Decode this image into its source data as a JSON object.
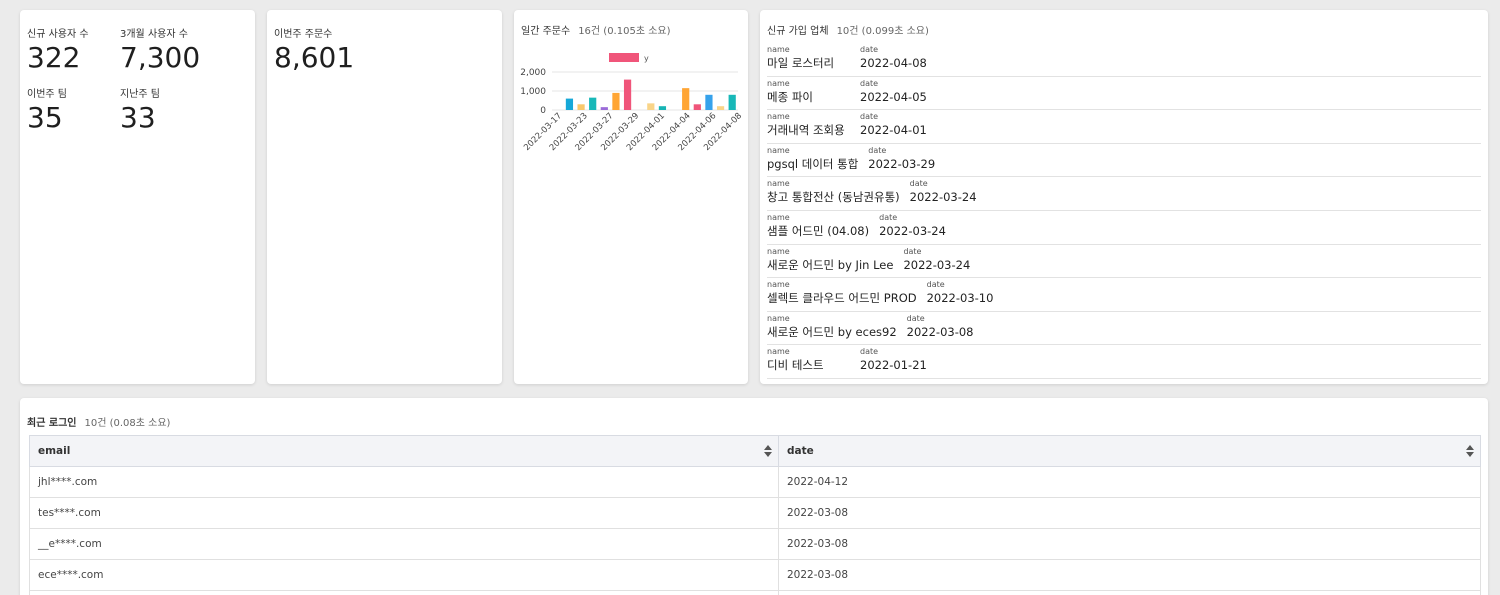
{
  "stats": {
    "new_users_label": "신규 사용자 수",
    "new_users_value": "322",
    "users_3m_label": "3개월 사용자 수",
    "users_3m_value": "7,300",
    "this_week_teams_label": "이번주 팀",
    "this_week_teams_value": "35",
    "last_week_teams_label": "지난주 팀",
    "last_week_teams_value": "33"
  },
  "orders": {
    "label": "이번주 주문수",
    "value": "8,601"
  },
  "daily_orders": {
    "title": "일간 주문수",
    "meta": "16건 (0.105초 소요)"
  },
  "chart_data": {
    "type": "bar",
    "legend": [
      "y"
    ],
    "legend_position": "top",
    "ylim": [
      0,
      2000
    ],
    "yticks": [
      "0",
      "1,000",
      "2,000"
    ],
    "xticks": [
      "2022-03-17",
      "2022-03-23",
      "2022-03-27",
      "2022-03-29",
      "2022-04-01",
      "2022-04-04",
      "2022-04-06",
      "2022-04-08"
    ],
    "x": [
      "2022-03-17",
      "2022-03-19",
      "2022-03-23",
      "2022-03-25",
      "2022-03-27",
      "2022-03-28",
      "2022-03-29",
      "2022-03-30",
      "2022-04-01",
      "2022-04-02",
      "2022-04-04",
      "2022-04-05",
      "2022-04-06",
      "2022-04-07",
      "2022-04-08",
      "2022-04-09"
    ],
    "series": [
      {
        "name": "y",
        "values": [
          0,
          600,
          300,
          650,
          150,
          900,
          1600,
          0,
          350,
          200,
          0,
          1150,
          300,
          800,
          200,
          800
        ]
      }
    ],
    "legend_color": "#f0557a",
    "bar_colors": [
      "#36a2eb",
      "#16a8d8",
      "#f9c86b",
      "#18b8b8",
      "#9b6bd8",
      "#ffa534",
      "#f0557a",
      "#ffffff",
      "#f9d488",
      "#17b4b4",
      "#ffffff",
      "#ffa534",
      "#f0557a",
      "#36a2eb",
      "#f9d488",
      "#18b8b8"
    ]
  },
  "signups": {
    "title": "신규 가입 업체",
    "meta": "10건 (0.099초 소요)",
    "name_key": "name",
    "date_key": "date",
    "rows": [
      {
        "name": "마일 로스터리",
        "date": "2022-04-08"
      },
      {
        "name": "메종 파이",
        "date": "2022-04-05"
      },
      {
        "name": "거래내역 조회용",
        "date": "2022-04-01"
      },
      {
        "name": "pgsql 데이터 통합",
        "date": "2022-03-29"
      },
      {
        "name": "창고 통합전산 (동남권유통)",
        "date": "2022-03-24"
      },
      {
        "name": "샘플 어드민 (04.08)",
        "date": "2022-03-24"
      },
      {
        "name": "새로운 어드민 by Jin Lee",
        "date": "2022-03-24"
      },
      {
        "name": "셀렉트 클라우드 어드민 PROD",
        "date": "2022-03-10"
      },
      {
        "name": "새로운 어드민 by eces92",
        "date": "2022-03-08"
      },
      {
        "name": "디비 테스트",
        "date": "2022-01-21"
      }
    ]
  },
  "logins": {
    "title": "최근 로그인",
    "meta": "10건 (0.08초 소요)",
    "columns": [
      "email",
      "date"
    ],
    "rows": [
      {
        "email": "jhl****.com",
        "date": "2022-04-12"
      },
      {
        "email": "tes****.com",
        "date": "2022-03-08"
      },
      {
        "email": "__e****.com",
        "date": "2022-03-08"
      },
      {
        "email": "ece****.com",
        "date": "2022-03-08"
      },
      {
        "email": "",
        "date": ""
      }
    ]
  }
}
